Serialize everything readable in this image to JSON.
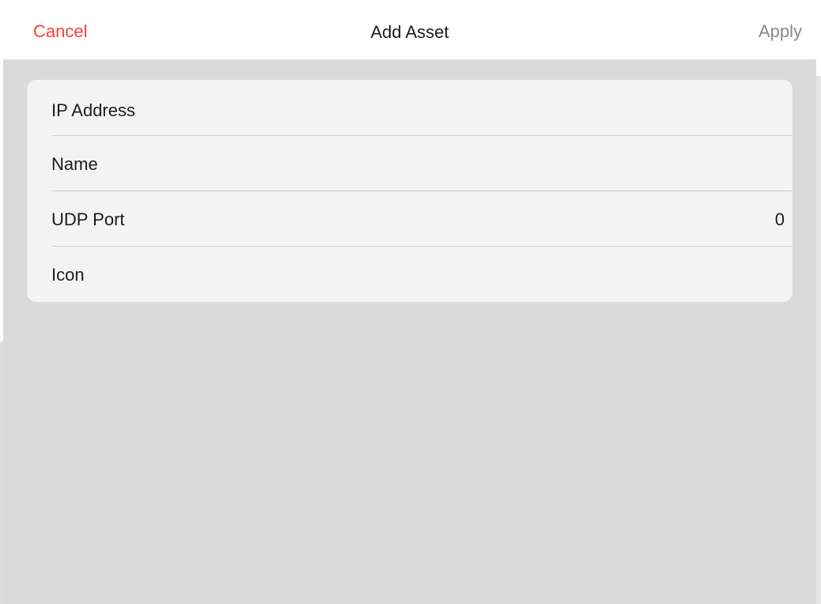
{
  "navbar": {
    "cancel_label": "Cancel",
    "title": "Add Asset",
    "apply_label": "Apply"
  },
  "form": {
    "rows": [
      {
        "label": "IP Address",
        "value": ""
      },
      {
        "label": "Name",
        "value": ""
      },
      {
        "label": "UDP Port",
        "value": "0"
      },
      {
        "label": "Icon",
        "value": ""
      }
    ]
  },
  "colors": {
    "cancel": "#f04438",
    "apply_disabled": "#8a8a8a",
    "sheet_background": "#dadada",
    "card_background": "#f3f3f3"
  }
}
